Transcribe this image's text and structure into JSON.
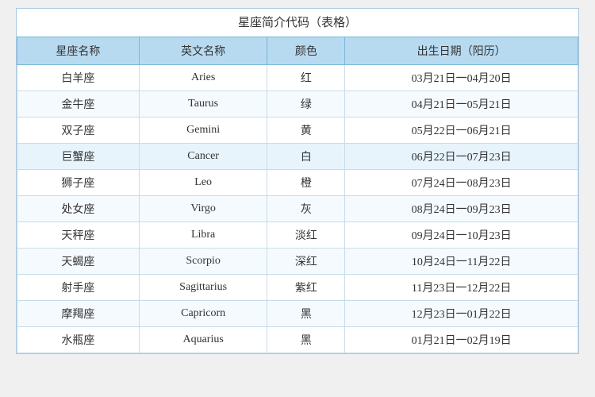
{
  "title": "星座简介代码（表格）",
  "headers": [
    "星座名称",
    "英文名称",
    "颜色",
    "出生日期（阳历）"
  ],
  "rows": [
    {
      "chinese": "白羊座",
      "english": "Aries",
      "color": "红",
      "date": "03月21日一04月20日"
    },
    {
      "chinese": "金牛座",
      "english": "Taurus",
      "color": "绿",
      "date": "04月21日一05月21日"
    },
    {
      "chinese": "双子座",
      "english": "Gemini",
      "color": "黄",
      "date": "05月22日一06月21日"
    },
    {
      "chinese": "巨蟹座",
      "english": "Cancer",
      "color": "白",
      "date": "06月22日一07月23日"
    },
    {
      "chinese": "狮子座",
      "english": "Leo",
      "color": "橙",
      "date": "07月24日一08月23日"
    },
    {
      "chinese": "处女座",
      "english": "Virgo",
      "color": "灰",
      "date": "08月24日一09月23日"
    },
    {
      "chinese": "天秤座",
      "english": "Libra",
      "color": "淡红",
      "date": "09月24日一10月23日"
    },
    {
      "chinese": "天蝎座",
      "english": "Scorpio",
      "color": "深红",
      "date": "10月24日一11月22日"
    },
    {
      "chinese": "射手座",
      "english": "Sagittarius",
      "color": "紫红",
      "date": "11月23日一12月22日"
    },
    {
      "chinese": "摩羯座",
      "english": "Capricorn",
      "color": "黑",
      "date": "12月23日一01月22日"
    },
    {
      "chinese": "水瓶座",
      "english": "Aquarius",
      "color": "黑",
      "date": "01月21日一02月19日"
    }
  ]
}
